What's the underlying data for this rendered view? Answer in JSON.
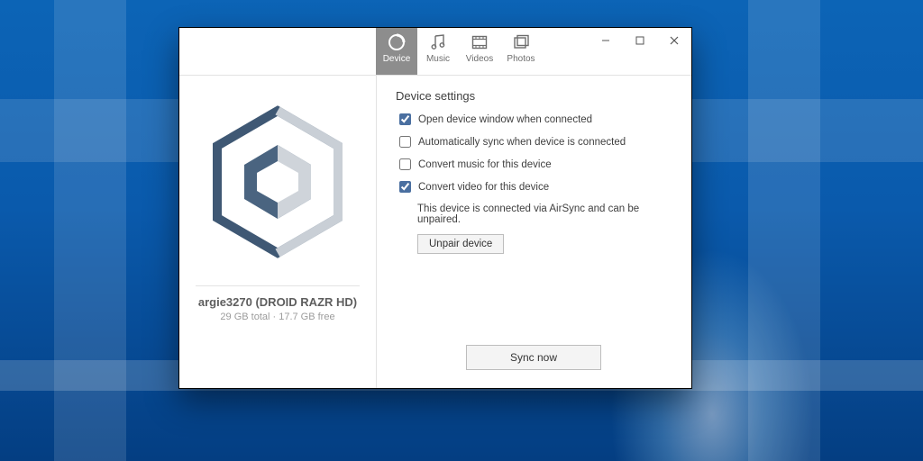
{
  "tabs": {
    "device": "Device",
    "music": "Music",
    "videos": "Videos",
    "photos": "Photos"
  },
  "device": {
    "name": "argie3270 (DROID RAZR HD)",
    "storage": "29 GB total · 17.7 GB free"
  },
  "settings": {
    "title": "Device settings",
    "opt_open_window": "Open device window when connected",
    "opt_auto_sync": "Automatically sync when device is connected",
    "opt_convert_music": "Convert music for this device",
    "opt_convert_video": "Convert video for this device",
    "checked": {
      "open_window": true,
      "auto_sync": false,
      "convert_music": false,
      "convert_video": true
    },
    "status_text": "This device is connected via AirSync and can be unpaired.",
    "unpair_label": "Unpair device",
    "sync_label": "Sync now"
  }
}
